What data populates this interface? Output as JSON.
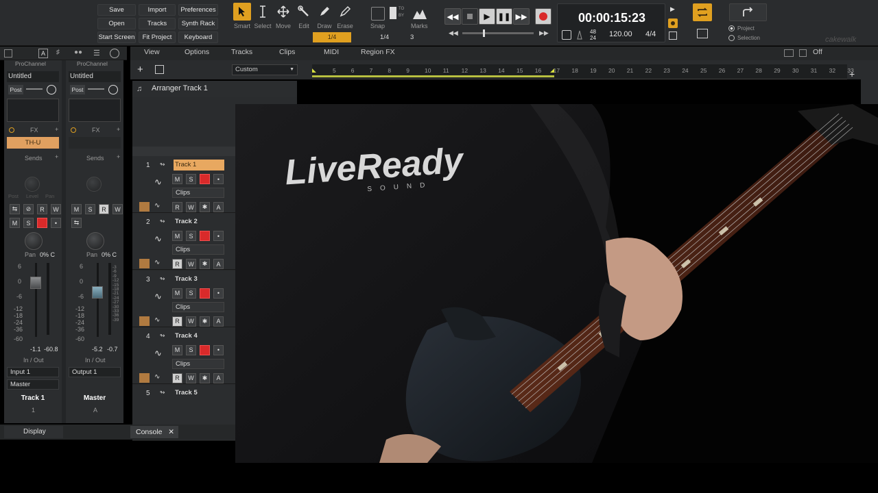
{
  "controlbar": {
    "file_buttons": [
      "Save",
      "Import",
      "Preferences",
      "Open",
      "Tracks",
      "Synth Rack",
      "Start Screen",
      "Fit Project",
      "Keyboard"
    ],
    "tools": [
      {
        "label": "Smart",
        "icon": "pointer-icon",
        "active": true
      },
      {
        "label": "Select",
        "icon": "ibeam-icon"
      },
      {
        "label": "Move",
        "icon": "move-icon"
      },
      {
        "label": "Edit",
        "icon": "wrench-icon"
      },
      {
        "label": "Draw",
        "icon": "pencil-icon"
      },
      {
        "label": "Erase",
        "icon": "eraser-icon"
      }
    ],
    "snap_value": "1/4",
    "snap_label": "Snap",
    "marks_label": "Marks",
    "snap_grid": "1/4",
    "snap_count": "3",
    "snap_to": "TO",
    "snap_by": "BY",
    "time": "00:00:15:23",
    "sample_rate_top": "48",
    "sample_rate_bottom": "24",
    "tempo": "120.00",
    "meter": "4/4",
    "export_mode_1": "Project",
    "export_mode_2": "Selection",
    "brand": "cakewalk"
  },
  "inspector": {
    "strips": [
      {
        "header": "ProChannel",
        "title": "Untitled",
        "post": "Post",
        "fx_label": "FX",
        "fx_slot": "TH-U",
        "sends": "Sends",
        "pan": "Pan",
        "pan_val": "0% C",
        "vol": "-1.1",
        "peak": "-60.8",
        "io": "In / Out",
        "input": "Input 1",
        "output": "Master",
        "name": "Track 1",
        "number": "1"
      },
      {
        "header": "ProChannel",
        "title": "Untitled",
        "post": "Post",
        "fx_label": "FX",
        "fx_slot": "",
        "sends": "Sends",
        "pan": "Pan",
        "pan_val": "0% C",
        "vol": "-5.2",
        "peak": "-0.7",
        "io": "In / Out",
        "input": "Output 1",
        "output": "",
        "name": "Master",
        "number": "A"
      }
    ],
    "knob_labels": [
      "Post",
      "Level",
      "Pan"
    ],
    "fader_scale": [
      "6",
      "0",
      "-6",
      "-12",
      "-18",
      "-24",
      "-36",
      "-60"
    ],
    "meter_scale": [
      "-3",
      "-6",
      "-9",
      "-12",
      "-15",
      "-18",
      "-21",
      "-24",
      "-27",
      "-30",
      "-33",
      "-36",
      "-39"
    ],
    "display_label": "Display"
  },
  "menu": [
    "View",
    "Options",
    "Tracks",
    "Clips",
    "MIDI",
    "Region FX"
  ],
  "menu_right": "Off",
  "track_view": {
    "preset": "Custom",
    "arranger": "Arranger Track 1",
    "ruler": [
      "5",
      "6",
      "7",
      "8",
      "9",
      "10",
      "11",
      "12",
      "13",
      "14",
      "15",
      "16",
      "17",
      "18",
      "19",
      "20",
      "21",
      "22",
      "23",
      "24",
      "25",
      "26",
      "27",
      "28",
      "29",
      "30",
      "31",
      "32",
      "33"
    ],
    "tracks": [
      {
        "num": "1",
        "name": "Track 1",
        "selected": true,
        "clips": "Clips"
      },
      {
        "num": "2",
        "name": "Track 2",
        "selected": false,
        "clips": "Clips"
      },
      {
        "num": "3",
        "name": "Track 3",
        "selected": false,
        "clips": "Clips"
      },
      {
        "num": "4",
        "name": "Track 4",
        "selected": false,
        "clips": "Clips"
      },
      {
        "num": "5",
        "name": "Track 5",
        "selected": false,
        "clips": ""
      }
    ],
    "track_buttons": [
      "M",
      "S",
      "R",
      "W",
      "A"
    ]
  },
  "console_tab": "Console",
  "video": {
    "shirt_logo": "LiveReady",
    "shirt_sub": "SOUND"
  },
  "colors": {
    "accent": "#e0a020",
    "record": "#d92a2a",
    "selected_track": "#e8a860",
    "loop": "#b8c040"
  }
}
